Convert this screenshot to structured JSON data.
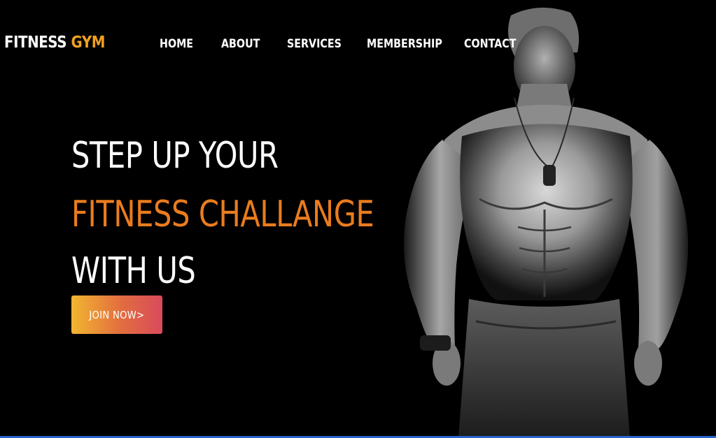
{
  "brand": {
    "name_part1": "FITNESS",
    "name_part2": "GYM"
  },
  "nav": {
    "items": [
      {
        "label": "HOME"
      },
      {
        "label": "ABOUT"
      },
      {
        "label": "SERVICES"
      },
      {
        "label": "MEMBERSHIP"
      },
      {
        "label": "CONTACT"
      }
    ]
  },
  "hero": {
    "line1": "STEP UP YOUR",
    "line2": "FITNESS CHALLANGE",
    "line3": "WITH US",
    "cta_label": "JOIN NOW>"
  },
  "colors": {
    "accent_orange": "#ea7c1e",
    "logo_yellow": "#f0a020",
    "background": "#000000",
    "button_gradient_start": "#f2b630",
    "button_gradient_end": "#d84a5c"
  }
}
